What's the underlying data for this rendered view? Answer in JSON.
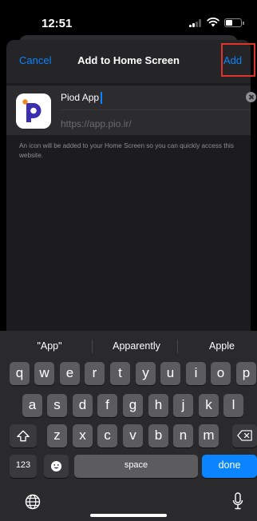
{
  "status_bar": {
    "time": "12:51"
  },
  "nav": {
    "cancel": "Cancel",
    "title": "Add to Home Screen",
    "add": "Add"
  },
  "form": {
    "name_value": "Piod App",
    "url": "https://app.pio.ir/"
  },
  "description": "An icon will be added to your Home Screen so you can quickly access this website.",
  "keyboard": {
    "suggestions": [
      "\"App\"",
      "Apparently",
      "Apple"
    ],
    "row1": [
      "q",
      "w",
      "e",
      "r",
      "t",
      "y",
      "u",
      "i",
      "o",
      "p"
    ],
    "row2": [
      "a",
      "s",
      "d",
      "f",
      "g",
      "h",
      "j",
      "k",
      "l"
    ],
    "row3": [
      "z",
      "x",
      "c",
      "v",
      "b",
      "n",
      "m"
    ],
    "numbers_key": "123",
    "space_key": "space",
    "done_key": "done"
  },
  "icons": {
    "shift": "shift-icon",
    "delete": "delete-icon",
    "emoji": "emoji-icon",
    "globe": "globe-icon",
    "mic": "microphone-icon"
  },
  "colors": {
    "accent": "#0a84ff",
    "highlight": "#e0332b",
    "brand": "#3b2fb0"
  }
}
